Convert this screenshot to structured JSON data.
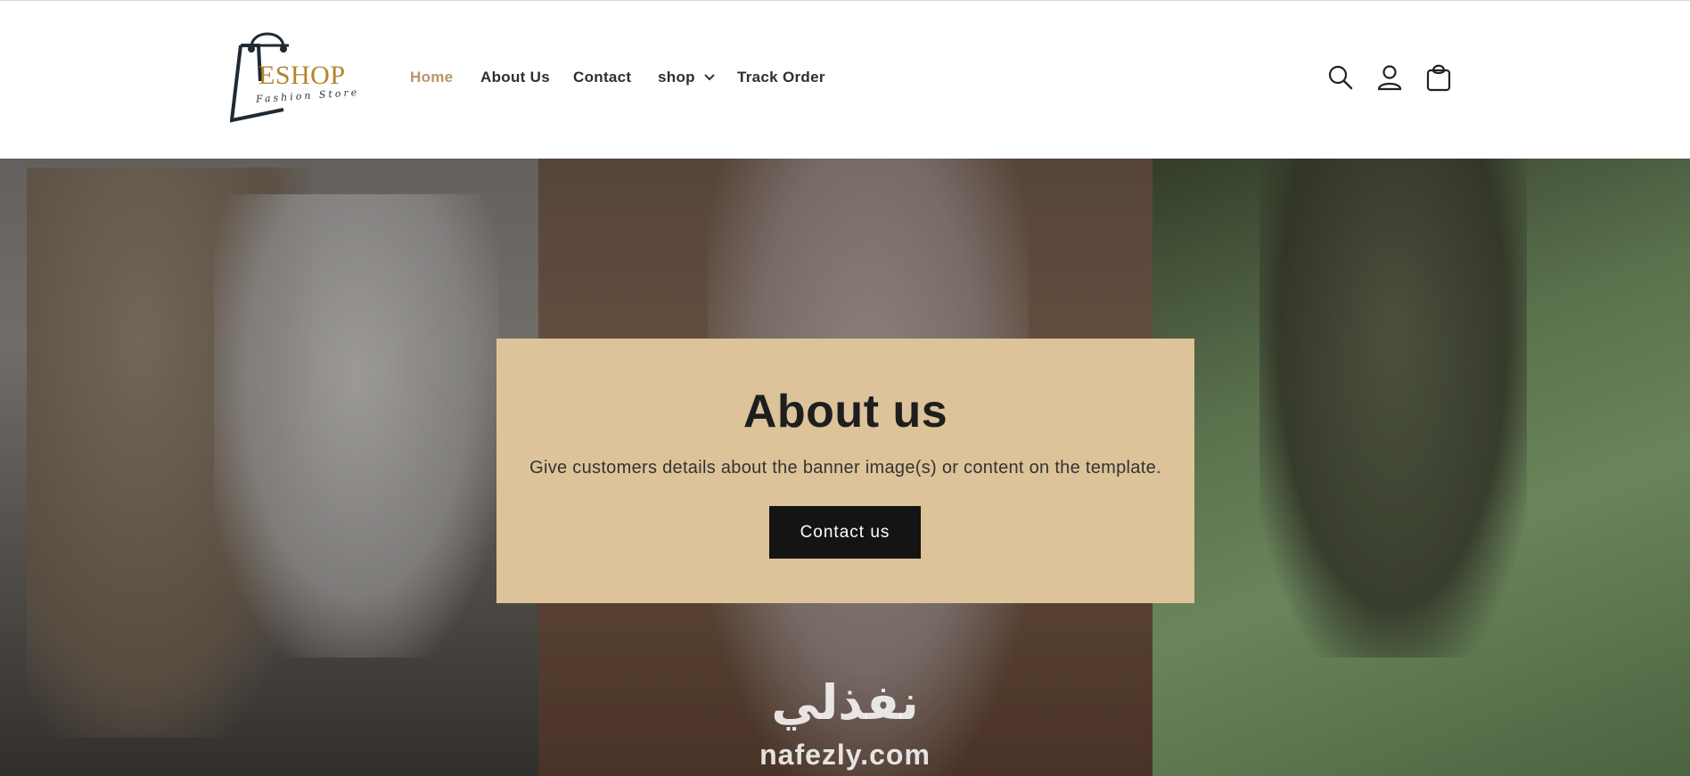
{
  "logo": {
    "brand": "ESHOP",
    "tagline": "Fashion Store"
  },
  "nav": {
    "items": [
      {
        "label": "Home",
        "active": true
      },
      {
        "label": "About Us"
      },
      {
        "label": "Contact"
      },
      {
        "label": "shop",
        "has_dropdown": true
      },
      {
        "label": "Track Order"
      }
    ]
  },
  "header_icons": [
    "search-icon",
    "account-icon",
    "cart-icon"
  ],
  "banner": {
    "title": "About us",
    "text": "Give customers details about the banner image(s) or content on the template.",
    "button_label": "Contact us"
  },
  "watermark": {
    "arabic": "نفذلي",
    "url": "nafezly.com"
  },
  "colors": {
    "accent": "#b8956a",
    "card_bg": "#dcc399",
    "button_bg": "#141414",
    "logo_gold": "#b4842a"
  }
}
